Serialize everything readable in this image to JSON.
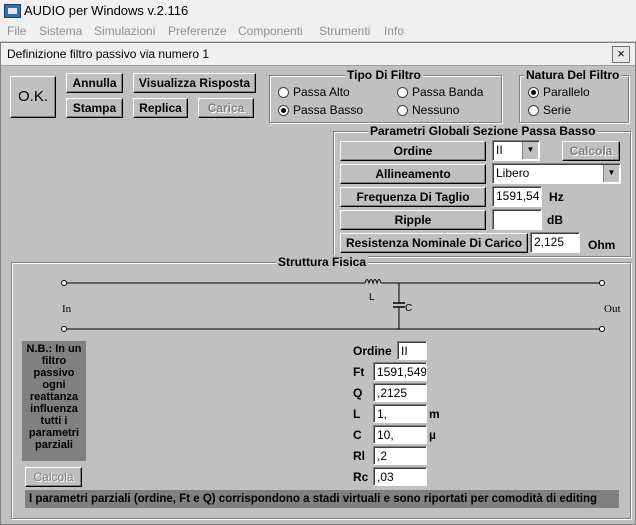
{
  "window": {
    "title": "AUDIO per Windows v.2.116"
  },
  "menu": [
    "File",
    "Sistema",
    "Simulazioni",
    "Preferenze",
    "Componenti",
    "Strumenti",
    "Info"
  ],
  "dialog": {
    "title": "Definizione filtro passivo via numero 1",
    "close": "×"
  },
  "buttons": {
    "ok": "O.K.",
    "annulla": "Annulla",
    "visualizza": "Visualizza Risposta",
    "stampa": "Stampa",
    "replica": "Replica",
    "carica": "Carica"
  },
  "tipo_filtro": {
    "title": "Tipo Di Filtro",
    "options": [
      {
        "label": "Passa Alto",
        "selected": false
      },
      {
        "label": "Passa Banda",
        "selected": false
      },
      {
        "label": "Passa Basso",
        "selected": true
      },
      {
        "label": "Nessuno",
        "selected": false
      }
    ]
  },
  "natura_filtro": {
    "title": "Natura Del Filtro",
    "options": [
      {
        "label": "Parallelo",
        "selected": true
      },
      {
        "label": "Serie",
        "selected": false
      }
    ]
  },
  "parametri": {
    "title": "Parametri Globali Sezione Passa Basso",
    "ordine_label": "Ordine",
    "ordine_value": "II",
    "calcola": "Calcola",
    "allineamento_label": "Allineamento",
    "allineamento_value": "Libero",
    "frequenza_label": "Frequenza Di Taglio",
    "frequenza_value": "1591,54",
    "frequenza_unit": "Hz",
    "ripple_label": "Ripple",
    "ripple_value": "",
    "ripple_unit": "dB",
    "resistenza_label": "Resistenza Nominale Di Carico",
    "resistenza_value": "2,125",
    "resistenza_unit": "Ohm"
  },
  "struttura": {
    "title": "Struttura Fisica",
    "in_label": "In",
    "out_label": "Out",
    "l_label": "L",
    "c_label": "C",
    "nb_text": "N.B.: In un\nfiltro\npassivo\nogni\nreattanza\ninfluenza\ntutti i\nparametri\nparziali",
    "calcola": "Calcola",
    "params": {
      "ordine_label": "Ordine",
      "ordine_value": "II",
      "ft_label": "Ft",
      "ft_value": "1591,549",
      "q_label": "Q",
      "q_value": ",2125",
      "l_label": "L",
      "l_value": "1,",
      "l_unit": "m",
      "c_label": "C",
      "c_value": "10,",
      "c_unit": "µ",
      "rl_label": "Rl",
      "rl_value": ",2",
      "rc_label": "Rc",
      "rc_value": ",03"
    },
    "footer": "I parametri parziali (ordine, Ft e Q) corrispondono a stadi virtuali e sono riportati per comodità di editing"
  }
}
